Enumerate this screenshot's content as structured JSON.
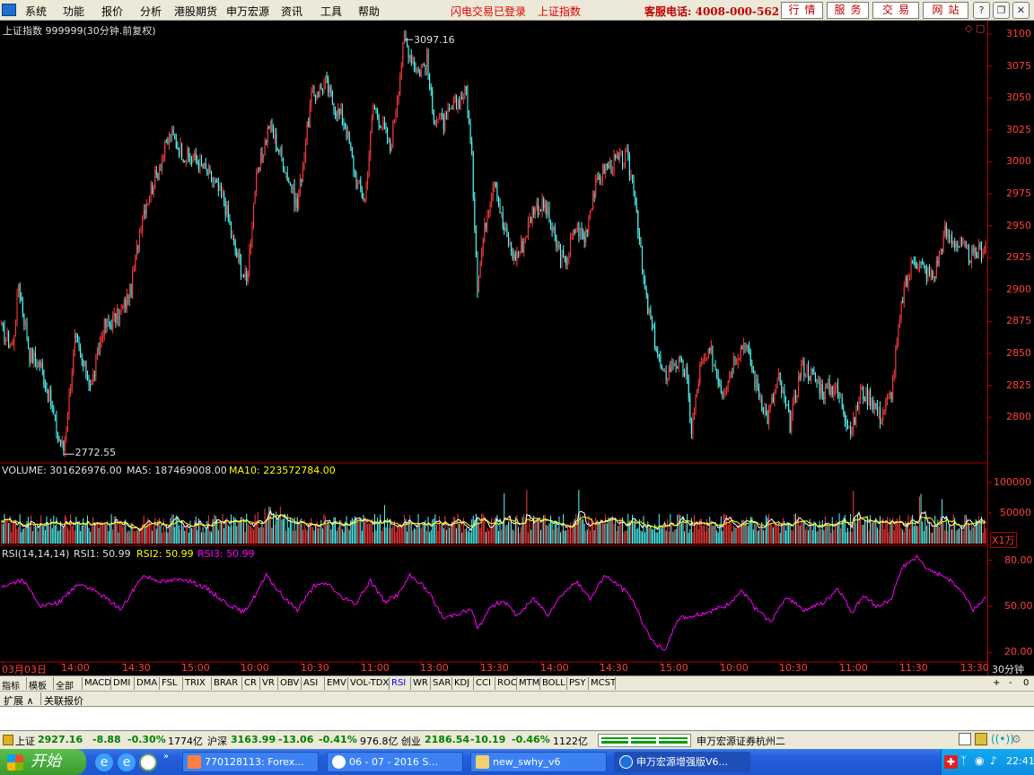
{
  "menubar": {
    "items": [
      "系统",
      "功能",
      "报价",
      "分析",
      "港股期货",
      "申万宏源",
      "资讯",
      "工具",
      "帮助"
    ],
    "status_login": "闪电交易已登录",
    "status_index": "上证指数",
    "hotline": "客服电话: 4008-000-562",
    "buttons": [
      "行情",
      "服务",
      "交易",
      "网站"
    ]
  },
  "chart": {
    "title": "上证指数 999999(30分钟.前复权)",
    "price_ticks": [
      "3100",
      "3075",
      "3050",
      "3025",
      "3000",
      "2975",
      "2950",
      "2925",
      "2900",
      "2875",
      "2850",
      "2825",
      "2800"
    ],
    "high_label": "3097.16",
    "low_label": "2772.55",
    "volume_label": "VOLUME: 301626976.00",
    "ma5_label": "MA5: 187469008.00",
    "ma10_label": "MA10: 223572784.00",
    "volume_ticks": [
      "100000",
      "50000"
    ],
    "volume_unit": "X1万",
    "rsi_label": "RSI(14,14,14)",
    "rsi1_label": "RSI1: 50.99",
    "rsi2_label": "RSI2: 50.99",
    "rsi3_label": "RSI3: 50.99",
    "rsi_ticks": [
      "80.00",
      "50.00",
      "20.00"
    ],
    "time_labels": [
      "03月03日",
      "14:00",
      "14:30",
      "15:00",
      "10:00",
      "10:30",
      "11:00",
      "13:00",
      "13:30",
      "14:00",
      "14:30",
      "15:00",
      "10:00",
      "10:30",
      "11:00",
      "11:30",
      "13:30"
    ],
    "period": "30分钟",
    "colors": {
      "up": "#ff3b3b",
      "down": "#54ffff",
      "rsi": "#ff00ff",
      "ma5": "#ffffff",
      "ma10": "#ffff00",
      "axis": "#b00000"
    }
  },
  "chart_data": {
    "type": "candlestick",
    "title": "上证指数 999999(30分钟.前复权)",
    "ylim": [
      2765,
      3105
    ],
    "high": 3097.16,
    "low": 2772.55,
    "anchors": [
      [
        0,
        2868
      ],
      [
        8,
        2855
      ],
      [
        12,
        2905
      ],
      [
        20,
        2850
      ],
      [
        28,
        2840
      ],
      [
        36,
        2806
      ],
      [
        40,
        2785
      ],
      [
        44,
        2775
      ],
      [
        52,
        2860
      ],
      [
        58,
        2840
      ],
      [
        64,
        2825
      ],
      [
        72,
        2870
      ],
      [
        84,
        2880
      ],
      [
        92,
        2900
      ],
      [
        100,
        2960
      ],
      [
        110,
        2990
      ],
      [
        120,
        3022
      ],
      [
        130,
        3005
      ],
      [
        140,
        3000
      ],
      [
        150,
        2985
      ],
      [
        158,
        2970
      ],
      [
        166,
        2930
      ],
      [
        174,
        2905
      ],
      [
        180,
        2980
      ],
      [
        190,
        3030
      ],
      [
        200,
        3000
      ],
      [
        210,
        2965
      ],
      [
        220,
        3050
      ],
      [
        230,
        3062
      ],
      [
        236,
        3045
      ],
      [
        244,
        3030
      ],
      [
        252,
        2985
      ],
      [
        258,
        2970
      ],
      [
        264,
        3045
      ],
      [
        270,
        3030
      ],
      [
        276,
        3010
      ],
      [
        282,
        3060
      ],
      [
        286,
        3097
      ],
      [
        290,
        3085
      ],
      [
        296,
        3070
      ],
      [
        302,
        3080
      ],
      [
        306,
        3040
      ],
      [
        314,
        3030
      ],
      [
        322,
        3045
      ],
      [
        330,
        3055
      ],
      [
        334,
        3000
      ],
      [
        338,
        2905
      ],
      [
        344,
        2955
      ],
      [
        350,
        2990
      ],
      [
        356,
        2950
      ],
      [
        364,
        2925
      ],
      [
        370,
        2935
      ],
      [
        378,
        2965
      ],
      [
        386,
        2965
      ],
      [
        394,
        2935
      ],
      [
        400,
        2920
      ],
      [
        408,
        2950
      ],
      [
        414,
        2940
      ],
      [
        420,
        2975
      ],
      [
        428,
        2995
      ],
      [
        436,
        3000
      ],
      [
        444,
        3003
      ],
      [
        450,
        2975
      ],
      [
        455,
        2915
      ],
      [
        458,
        2890
      ],
      [
        464,
        2860
      ],
      [
        470,
        2830
      ],
      [
        478,
        2845
      ],
      [
        486,
        2835
      ],
      [
        490,
        2790
      ],
      [
        496,
        2838
      ],
      [
        504,
        2850
      ],
      [
        512,
        2820
      ],
      [
        520,
        2845
      ],
      [
        528,
        2860
      ],
      [
        536,
        2825
      ],
      [
        544,
        2800
      ],
      [
        552,
        2830
      ],
      [
        560,
        2795
      ],
      [
        568,
        2840
      ],
      [
        576,
        2833
      ],
      [
        584,
        2820
      ],
      [
        592,
        2825
      ],
      [
        600,
        2800
      ],
      [
        604,
        2788
      ],
      [
        610,
        2820
      ],
      [
        618,
        2815
      ],
      [
        624,
        2800
      ],
      [
        632,
        2820
      ],
      [
        640,
        2895
      ],
      [
        648,
        2925
      ],
      [
        656,
        2915
      ],
      [
        662,
        2910
      ],
      [
        670,
        2945
      ],
      [
        680,
        2935
      ],
      [
        690,
        2925
      ],
      [
        699,
        2935
      ]
    ],
    "volume": {
      "ylim": [
        0,
        110000
      ],
      "unit": "X1万",
      "mean": 35000
    },
    "rsi": {
      "ylim": [
        15,
        85
      ],
      "anchors": [
        [
          0,
          63
        ],
        [
          15,
          67
        ],
        [
          28,
          50
        ],
        [
          40,
          52
        ],
        [
          55,
          65
        ],
        [
          70,
          58
        ],
        [
          85,
          48
        ],
        [
          100,
          70
        ],
        [
          115,
          66
        ],
        [
          130,
          68
        ],
        [
          145,
          62
        ],
        [
          160,
          52
        ],
        [
          172,
          46
        ],
        [
          180,
          57
        ],
        [
          188,
          70
        ],
        [
          200,
          56
        ],
        [
          210,
          48
        ],
        [
          222,
          63
        ],
        [
          232,
          65
        ],
        [
          242,
          55
        ],
        [
          252,
          52
        ],
        [
          262,
          67
        ],
        [
          272,
          53
        ],
        [
          282,
          58
        ],
        [
          290,
          70
        ],
        [
          298,
          65
        ],
        [
          306,
          55
        ],
        [
          314,
          42
        ],
        [
          322,
          45
        ],
        [
          334,
          48
        ],
        [
          338,
          35
        ],
        [
          348,
          50
        ],
        [
          356,
          54
        ],
        [
          366,
          44
        ],
        [
          378,
          55
        ],
        [
          388,
          45
        ],
        [
          398,
          58
        ],
        [
          408,
          66
        ],
        [
          418,
          55
        ],
        [
          428,
          70
        ],
        [
          438,
          64
        ],
        [
          448,
          55
        ],
        [
          455,
          40
        ],
        [
          464,
          25
        ],
        [
          472,
          22
        ],
        [
          480,
          42
        ],
        [
          492,
          44
        ],
        [
          504,
          47
        ],
        [
          514,
          50
        ],
        [
          526,
          60
        ],
        [
          536,
          48
        ],
        [
          546,
          40
        ],
        [
          558,
          56
        ],
        [
          570,
          48
        ],
        [
          584,
          52
        ],
        [
          594,
          62
        ],
        [
          604,
          46
        ],
        [
          612,
          57
        ],
        [
          622,
          50
        ],
        [
          632,
          55
        ],
        [
          640,
          76
        ],
        [
          650,
          82
        ],
        [
          660,
          72
        ],
        [
          670,
          70
        ],
        [
          682,
          60
        ],
        [
          690,
          48
        ],
        [
          699,
          56
        ]
      ]
    },
    "time_labels": [
      "03月03日",
      "14:00",
      "14:30",
      "15:00",
      "10:00",
      "10:30",
      "11:00",
      "13:00",
      "13:30",
      "14:00",
      "14:30",
      "15:00",
      "10:00",
      "10:30",
      "11:00",
      "11:30",
      "13:30"
    ]
  },
  "indicator_tabs": [
    "指标",
    "模板",
    "全部",
    "MACD",
    "DMI",
    "DMA",
    "FSL",
    "TRIX",
    "BRAR",
    "CR",
    "VR",
    "OBV",
    "ASI",
    "EMV",
    "VOL-TDX",
    "RSI",
    "WR",
    "SAR",
    "KDJ",
    "CCI",
    "ROC",
    "MTM",
    "BOLL",
    "PSY",
    "MCST"
  ],
  "active_tab": "RSI",
  "ext_tabs": [
    "扩展 ∧",
    "关联报价"
  ],
  "right_controls": [
    "+",
    "-",
    "0"
  ],
  "statusbar": {
    "sh_name": "上证",
    "sh_value": "2927.16",
    "sh_change": "-8.88",
    "sh_pct": "-0.30%",
    "sh_amount": "1774亿",
    "hs_name": "沪深",
    "hs_value": "3163.99",
    "hs_change": "-13.06",
    "hs_pct": "-0.41%",
    "hs_amount": "976.8亿",
    "cy_name": "创业",
    "cy_value": "2186.54",
    "cy_change": "-10.19",
    "cy_pct": "-0.46%",
    "cy_amount": "1122亿",
    "broker": "申万宏源证券杭州二"
  },
  "taskbar": {
    "start": "开始",
    "tasks": [
      "770128113: Forex...",
      "06 - 07 - 2016 S...",
      "new_swhy_v6",
      "申万宏源增强版V6..."
    ],
    "clock": "22:41"
  }
}
